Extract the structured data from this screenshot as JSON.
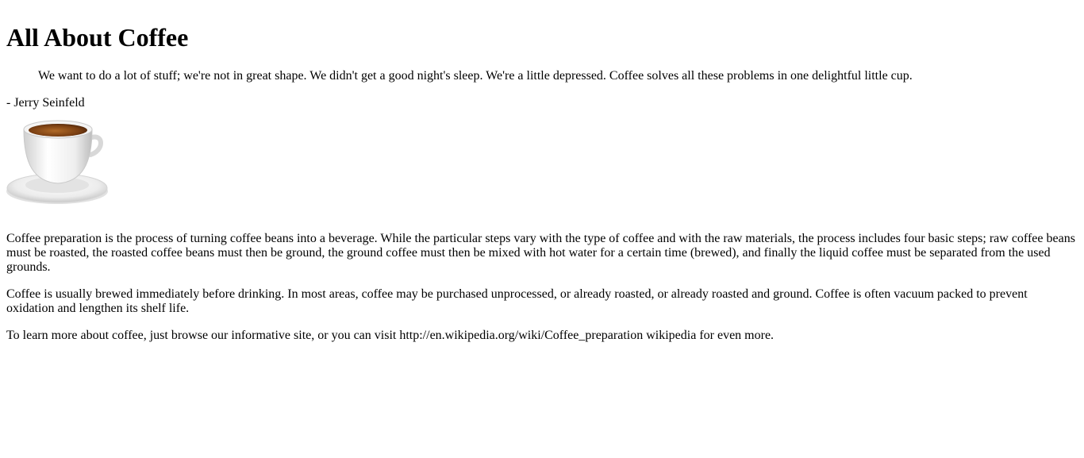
{
  "page": {
    "heading": "All About Coffee",
    "quote": "We want to do a lot of stuff; we're not in great shape. We didn't get a good night's sleep. We're a little depressed. Coffee solves all these problems in one delightful little cup.",
    "author": "- Jerry Seinfeld",
    "image_icon": "coffee-cup-icon",
    "paragraphs": [
      "Coffee preparation is the process of turning coffee beans into a beverage. While the particular steps vary with the type of coffee and with the raw materials, the process includes four basic steps; raw coffee beans must be roasted, the roasted coffee beans must then be ground, the ground coffee must then be mixed with hot water for a certain time (brewed), and finally the liquid coffee must be separated from the used grounds.",
      "Coffee is usually brewed immediately before drinking. In most areas, coffee may be purchased unprocessed, or already roasted, or already roasted and ground. Coffee is often vacuum packed to prevent oxidation and lengthen its shelf life."
    ],
    "learn_more": "To learn more about coffee, just browse our informative site, or you can visit http://en.wikipedia.org/wiki/Coffee_preparation wikipedia for even more."
  }
}
